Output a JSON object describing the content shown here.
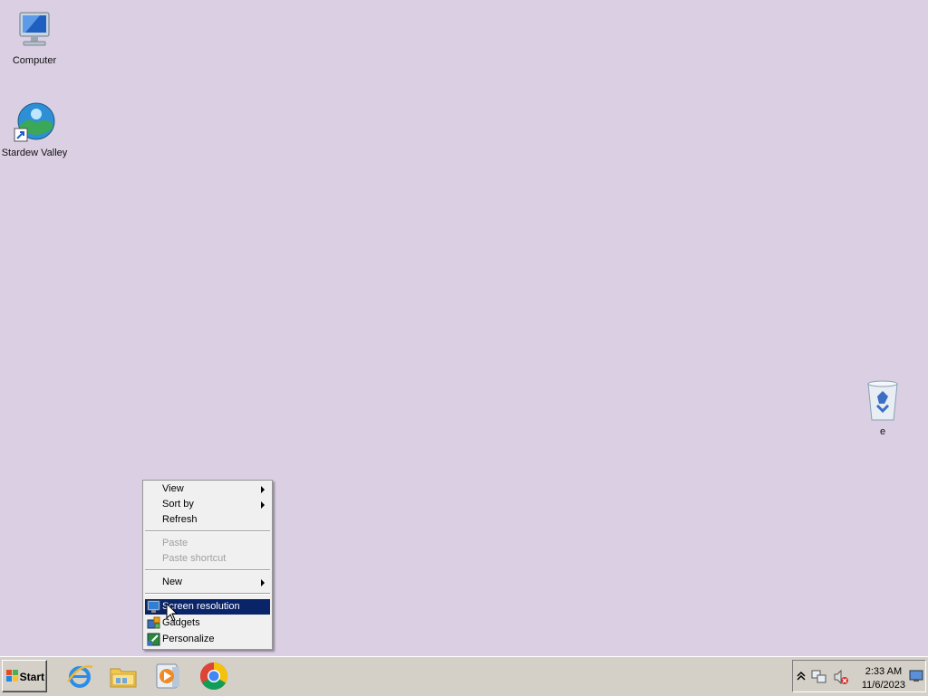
{
  "desktop": {
    "icons": [
      {
        "label": "Computer"
      },
      {
        "label": "Stardew Valley"
      },
      {
        "label": "e"
      }
    ]
  },
  "context_menu": {
    "items": [
      {
        "label": "View",
        "submenu": true,
        "enabled": true
      },
      {
        "label": "Sort by",
        "submenu": true,
        "enabled": true
      },
      {
        "label": "Refresh",
        "enabled": true
      },
      {
        "label": "Paste",
        "enabled": false
      },
      {
        "label": "Paste shortcut",
        "enabled": false
      },
      {
        "label": "New",
        "submenu": true,
        "enabled": true
      },
      {
        "label": "Screen resolution",
        "enabled": true,
        "highlighted": true,
        "icon": "monitor-icon"
      },
      {
        "label": "Gadgets",
        "enabled": true,
        "icon": "gadgets-icon"
      },
      {
        "label": "Personalize",
        "enabled": true,
        "icon": "personalize-icon"
      }
    ]
  },
  "taskbar": {
    "start_label": "Start",
    "pinned": [
      "internet-explorer-icon",
      "file-explorer-icon",
      "media-player-icon",
      "chrome-icon"
    ],
    "tray": {
      "time": "2:33 AM",
      "date": "11/6/2023",
      "icons": [
        "show-hidden-icons-chevron",
        "network-icon",
        "volume-muted-icon",
        "show-desktop-icon"
      ]
    }
  },
  "colors": {
    "desktop_background": "#dbcfe4",
    "menu_highlight": "#0a246a",
    "taskbar": "#d4d0c8"
  }
}
